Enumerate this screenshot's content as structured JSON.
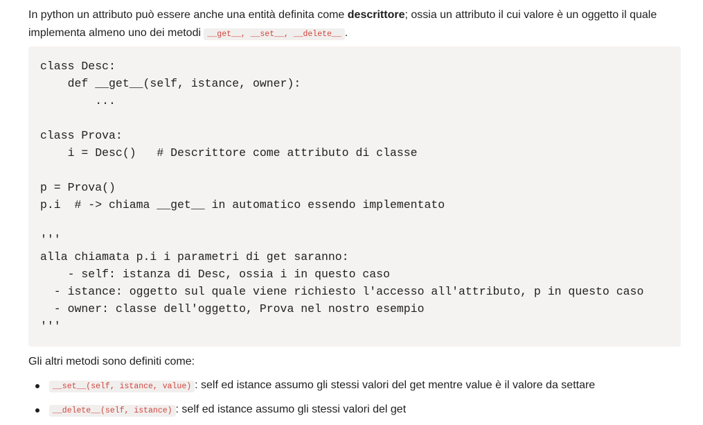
{
  "intro": {
    "text_before": "In python un attributo può essere anche una entità definita come ",
    "bold": "descrittore",
    "text_after": "; ossia un attributo il cui valore è un oggetto il quale implementa almeno uno dei metodi ",
    "inline_code": "__get__, __set__, __delete__",
    "end": "."
  },
  "code_block": "class Desc:\n    def __get__(self, istance, owner):\n        ...\n\nclass Prova:\n    i = Desc()   # Descrittore come attributo di classe\n\np = Prova()\np.i  # -> chiama __get__ in automatico essendo implementato\n\n'''\nalla chiamata p.i i parametri di get saranno:\n    - self: istanza di Desc, ossia i in questo caso\n  - istance: oggetto sul quale viene richiesto l'accesso all'attributo, p in questo caso\n  - owner: classe dell'oggetto, Prova nel nostro esempio\n'''",
  "methods_intro": "Gli altri metodi sono definiti come:",
  "bullets": [
    {
      "code": "__set__(self, istance, value)",
      "text": ": self ed istance assumo gli stessi valori del get mentre value è il valore da settare"
    },
    {
      "code": "__delete__(self, istance)",
      "text": ": self ed istance assumo gli stessi valori del get"
    }
  ]
}
